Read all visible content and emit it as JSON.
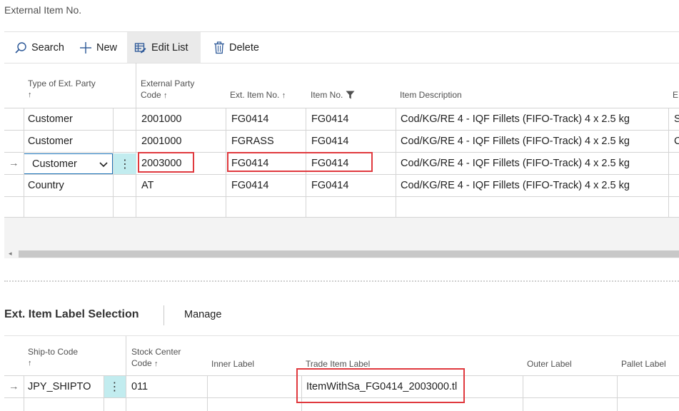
{
  "page": {
    "title": "External Item No."
  },
  "toolbar": {
    "search_label": "Search",
    "new_label": "New",
    "edit_list_label": "Edit List",
    "delete_label": "Delete"
  },
  "grid1": {
    "headers": {
      "type_of_ext_party": "Type of Ext. Party",
      "external_party_code_line1": "External Party",
      "external_party_code_line2": "Code",
      "ext_item_no": "Ext. Item No.",
      "item_no": "Item No.",
      "item_description": "Item Description",
      "cut_col": "E"
    },
    "sort_arrow": "↑",
    "rows": [
      {
        "type": "Customer",
        "code": "2001000",
        "ext_item": "FG0414",
        "item": "FG0414",
        "desc": "Cod/KG/RE 4 - IQF Fillets (FIFO-Track) 4 x 2.5 kg",
        "extra": "S"
      },
      {
        "type": "Customer",
        "code": "2001000",
        "ext_item": "FGRASS",
        "item": "FG0414",
        "desc": "Cod/KG/RE 4 - IQF Fillets (FIFO-Track) 4 x 2.5 kg",
        "extra": "C"
      },
      {
        "type": "Customer",
        "code": "2003000",
        "ext_item": "FG0414",
        "item": "FG0414",
        "desc": "Cod/KG/RE 4 - IQF Fillets (FIFO-Track) 4 x 2.5 kg",
        "extra": ""
      },
      {
        "type": "Country",
        "code": "AT",
        "ext_item": "FG0414",
        "item": "FG0414",
        "desc": "Cod/KG/RE 4 - IQF Fillets (FIFO-Track) 4 x 2.5 kg",
        "extra": ""
      }
    ],
    "row_pointer": "→",
    "dots": "⋮"
  },
  "subpage": {
    "title": "Ext. Item Label Selection",
    "manage_label": "Manage",
    "headers": {
      "ship_to_code": "Ship-to Code",
      "stock_center_line1": "Stock Center",
      "stock_center_line2": "Code",
      "inner_label": "Inner Label",
      "trade_item_label": "Trade Item Label",
      "outer_label": "Outer Label",
      "pallet_label": "Pallet Label"
    },
    "rows": [
      {
        "ship_to": "JPY_SHIPTO",
        "stock_center": "011",
        "inner": "",
        "trade": "ItemWithSa_FG0414_2003000.tl",
        "outer": "",
        "pallet": ""
      }
    ]
  },
  "colors": {
    "selection_accent": "#c2ecef",
    "highlight_red": "#e0393e"
  }
}
